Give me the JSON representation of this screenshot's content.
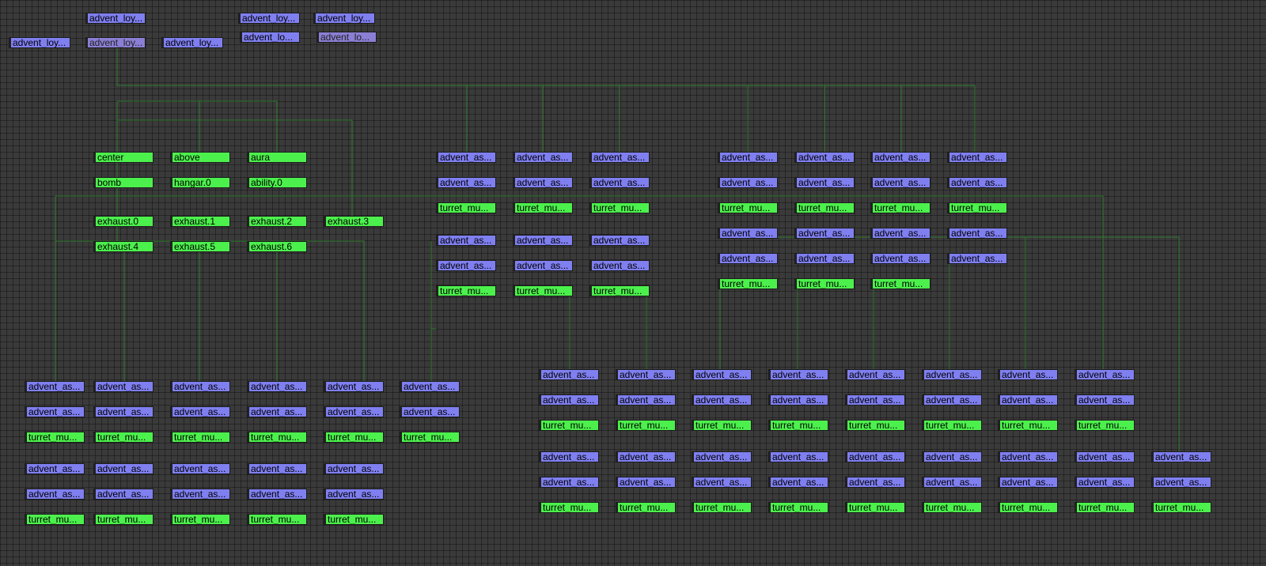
{
  "colors": {
    "node_purple": "#7f7ff0",
    "node_purple_dim": "#8a7fd4",
    "node_green": "#4cf04c",
    "wire": "#2f7a2f",
    "background": "#3a3a3a"
  },
  "top_nodes": [
    {
      "id": "root-a",
      "label": "advent_loy...",
      "color": "purple"
    },
    {
      "id": "root-b",
      "label": "advent_loy...",
      "color": "purple"
    },
    {
      "id": "root-c",
      "label": "advent_loy...",
      "color": "purple"
    },
    {
      "id": "root-d",
      "label": "advent_loy...",
      "color": "purple"
    },
    {
      "id": "root-e",
      "label": "advent_loy...",
      "color": "purple",
      "dim": true
    },
    {
      "id": "root-f",
      "label": "advent_loy...",
      "color": "purple"
    },
    {
      "id": "root-g",
      "label": "advent_lo...",
      "color": "purple"
    },
    {
      "id": "root-h",
      "label": "advent_lo...",
      "color": "purple",
      "dim": true
    }
  ],
  "anchor_nodes": [
    {
      "id": "center",
      "label": "center"
    },
    {
      "id": "above",
      "label": "above"
    },
    {
      "id": "aura",
      "label": "aura"
    },
    {
      "id": "bomb",
      "label": "bomb"
    },
    {
      "id": "hangar",
      "label": "hangar.0"
    },
    {
      "id": "ability",
      "label": "ability.0"
    },
    {
      "id": "exhaust0",
      "label": "exhaust.0"
    },
    {
      "id": "exhaust1",
      "label": "exhaust.1"
    },
    {
      "id": "exhaust2",
      "label": "exhaust.2"
    },
    {
      "id": "exhaust3",
      "label": "exhaust.3"
    },
    {
      "id": "exhaust4",
      "label": "exhaust.4"
    },
    {
      "id": "exhaust5",
      "label": "exhaust.5"
    },
    {
      "id": "exhaust6",
      "label": "exhaust.6"
    }
  ],
  "labels": {
    "assembly": "advent_as...",
    "turret": "turret_mu..."
  }
}
